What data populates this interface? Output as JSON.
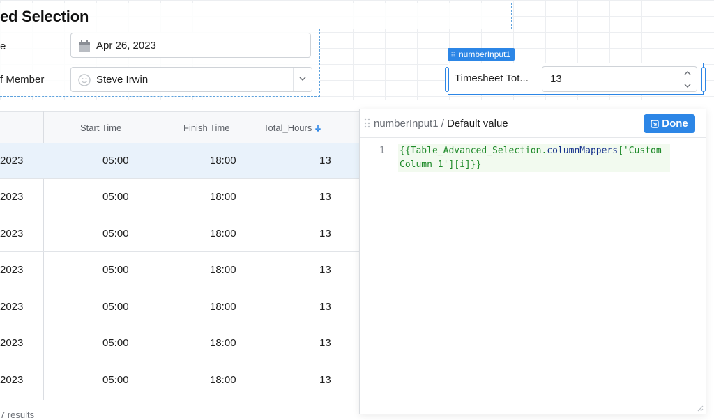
{
  "canvas": {
    "title": "ed Selection",
    "form": {
      "date_label": "e",
      "date_value": "Apr 26, 2023",
      "member_label": "f Member",
      "member_value": "Steve Irwin"
    },
    "number_input": {
      "tag": "numberInput1",
      "label": "Timesheet Tot...",
      "value": "13"
    }
  },
  "table": {
    "headers": [
      "Start Time",
      "Finish Time",
      "Total_Hours"
    ],
    "rows": [
      {
        "date": "2023",
        "start": "05:00",
        "finish": "18:00",
        "hours": "13"
      },
      {
        "date": "2023",
        "start": "05:00",
        "finish": "18:00",
        "hours": "13"
      },
      {
        "date": "2023",
        "start": "05:00",
        "finish": "18:00",
        "hours": "13"
      },
      {
        "date": "2023",
        "start": "05:00",
        "finish": "18:00",
        "hours": "13"
      },
      {
        "date": "2023",
        "start": "05:00",
        "finish": "18:00",
        "hours": "13"
      },
      {
        "date": "2023",
        "start": "05:00",
        "finish": "18:00",
        "hours": "13"
      },
      {
        "date": "2023",
        "start": "05:00",
        "finish": "18:00",
        "hours": "13"
      }
    ],
    "footer": "7 results"
  },
  "popover": {
    "crumb_widget": "numberInput1",
    "crumb_sep": " / ",
    "crumb_field": "Default value",
    "done_label": "Done",
    "line_number": "1",
    "code": {
      "open": "{{",
      "object": "Table_Advanced_Selection",
      "dot": ".",
      "prop": "columnMappers",
      "key_open": "[",
      "key_str": "'Custom Column 1'",
      "key_close": "]",
      "index": "[i]",
      "close": "}}"
    }
  },
  "colors": {
    "accent": "#2c86e6",
    "selected_row": "#e9f2fb",
    "code_bg": "#f2faef"
  }
}
